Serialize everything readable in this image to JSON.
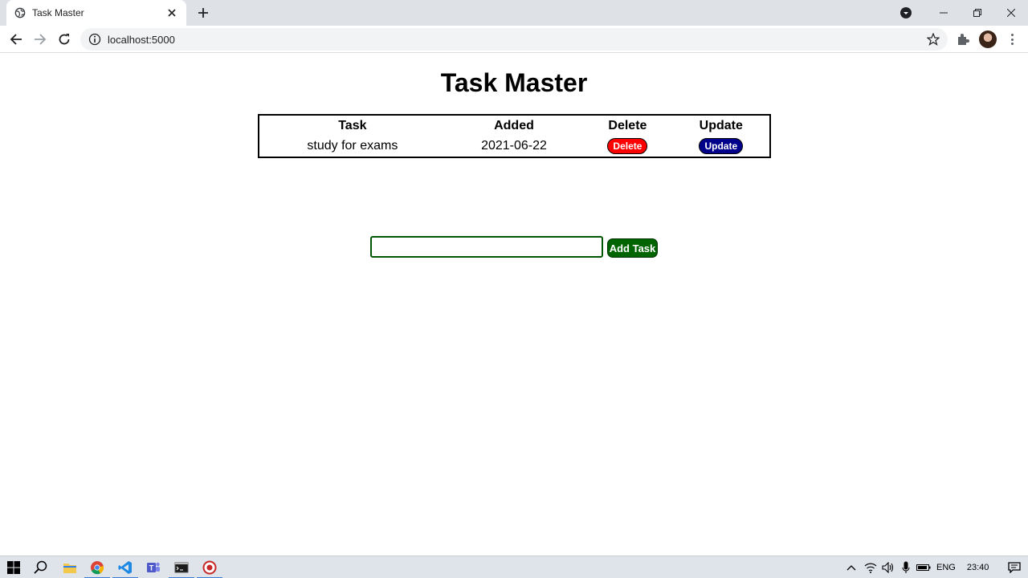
{
  "browser": {
    "tab_title": "Task Master",
    "url": "localhost:5000"
  },
  "page": {
    "title": "Task Master",
    "table": {
      "headers": [
        "Task",
        "Added",
        "Delete",
        "Update"
      ],
      "rows": [
        {
          "task": "study for exams",
          "added": "2021-06-22",
          "delete_label": "Delete",
          "update_label": "Update"
        }
      ]
    },
    "input": {
      "value": "",
      "placeholder": ""
    },
    "add_button_label": "Add Task"
  },
  "taskbar": {
    "apps": [
      "windows-start",
      "search",
      "file-explorer",
      "chrome",
      "vscode",
      "teams",
      "terminal",
      "record"
    ],
    "language": "ENG",
    "clock": "23:40"
  },
  "colors": {
    "delete": "#ff0000",
    "update": "#00008b",
    "add": "#006400",
    "input_border": "#005500"
  }
}
